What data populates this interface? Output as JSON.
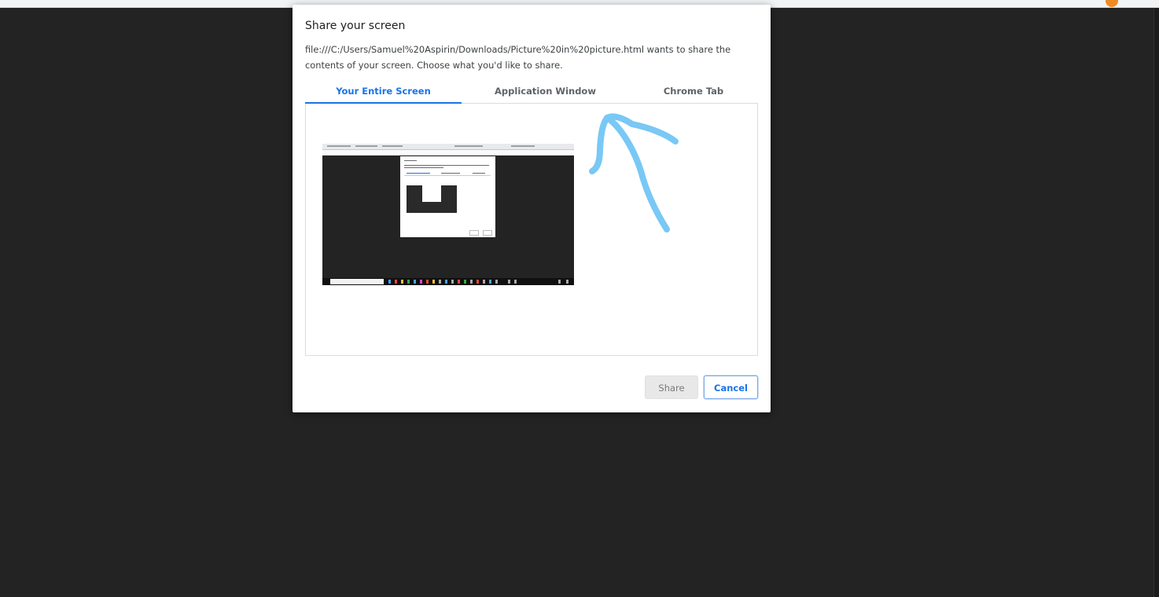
{
  "dialog": {
    "title": "Share your screen",
    "description": "file:///C:/Users/Samuel%20Aspirin/Downloads/Picture%20in%20picture.html wants to share the contents of your screen. Choose what you'd like to share.",
    "tabs": [
      {
        "label": "Your Entire Screen",
        "selected": true
      },
      {
        "label": "Application Window",
        "selected": false
      },
      {
        "label": "Chrome Tab",
        "selected": false
      }
    ],
    "thumbnail_icon": "screen-thumbnail",
    "share_label": "Share",
    "cancel_label": "Cancel"
  },
  "annotation": {
    "icon": "hand-drawn-arrow-icon",
    "color": "#79c8f5"
  },
  "colors": {
    "accent": "#1a73e8",
    "page_background": "#232323",
    "dialog_background": "#ffffff"
  }
}
